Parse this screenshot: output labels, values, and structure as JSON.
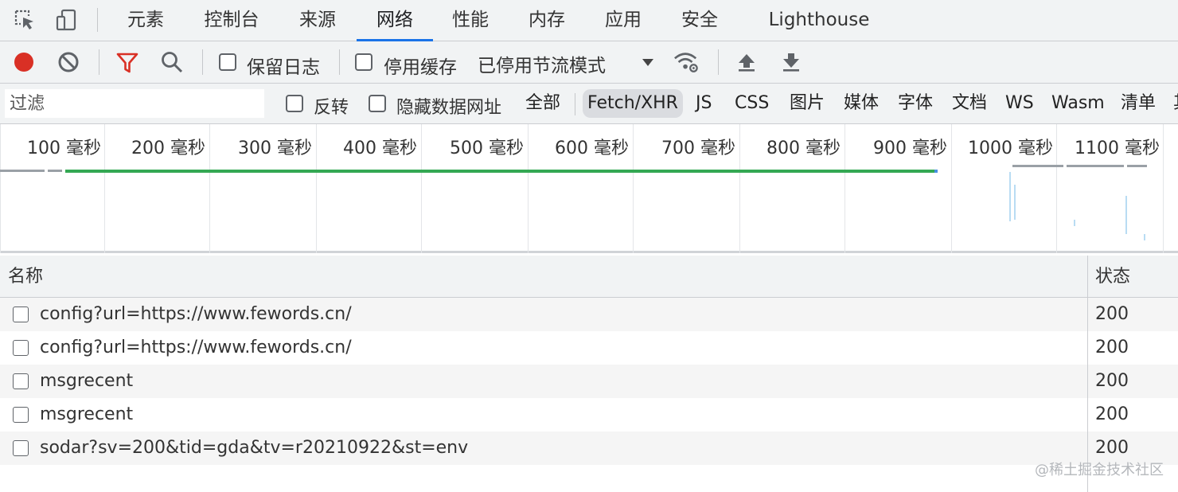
{
  "tabs": [
    {
      "label": "元素"
    },
    {
      "label": "控制台"
    },
    {
      "label": "来源"
    },
    {
      "label": "网络",
      "active": true
    },
    {
      "label": "性能"
    },
    {
      "label": "内存"
    },
    {
      "label": "应用"
    },
    {
      "label": "安全"
    },
    {
      "label": "Lighthouse"
    }
  ],
  "toolbar": {
    "preserve_log": "保留日志",
    "disable_cache": "停用缓存",
    "throttling": "已停用节流模式",
    "record_color": "#d93025",
    "filter_icon_color": "#d93025"
  },
  "filter": {
    "placeholder": "过滤",
    "invert": "反转",
    "hide_data_urls": "隐藏数据网址",
    "types": [
      {
        "label": "全部"
      },
      {
        "label": "Fetch/XHR",
        "active": true
      },
      {
        "label": "JS"
      },
      {
        "label": "CSS"
      },
      {
        "label": "图片"
      },
      {
        "label": "媒体"
      },
      {
        "label": "字体"
      },
      {
        "label": "文档"
      },
      {
        "label": "WS"
      },
      {
        "label": "Wasm"
      },
      {
        "label": "清单"
      },
      {
        "label": "其"
      }
    ]
  },
  "overview": {
    "ticks": [
      "100 毫秒",
      "200 毫秒",
      "300 毫秒",
      "400 毫秒",
      "500 毫秒",
      "600 毫秒",
      "700 毫秒",
      "800 毫秒",
      "900 毫秒",
      "1000 毫秒",
      "1100 毫秒"
    ],
    "green_bar_color": "#34a853"
  },
  "table": {
    "columns": {
      "name": "名称",
      "status": "状态"
    },
    "rows": [
      {
        "name": "config?url=https://www.fewords.cn/",
        "status": "200"
      },
      {
        "name": "config?url=https://www.fewords.cn/",
        "status": "200"
      },
      {
        "name": "msgrecent",
        "status": "200"
      },
      {
        "name": "msgrecent",
        "status": "200"
      },
      {
        "name": "sodar?sv=200&tid=gda&tv=r20210922&st=env",
        "status": "200"
      }
    ]
  },
  "watermark": "@稀土掘金技术社区"
}
